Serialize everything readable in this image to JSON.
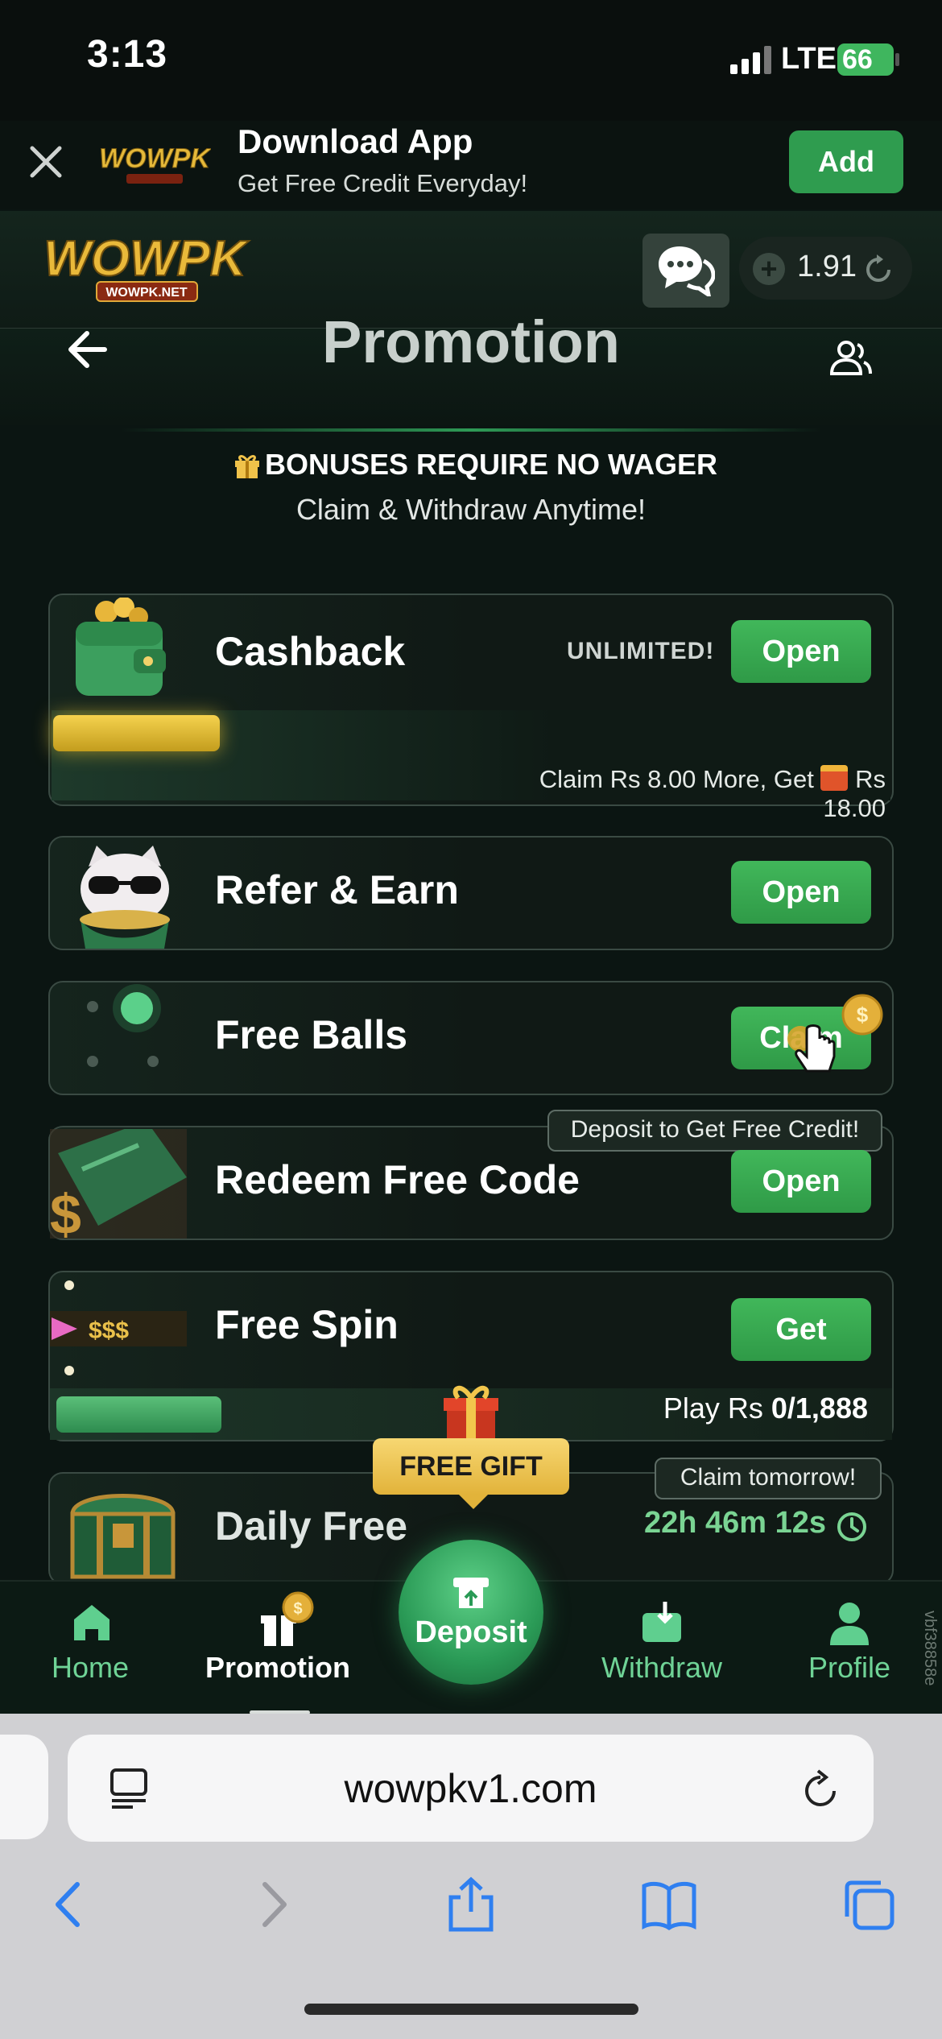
{
  "status": {
    "time": "3:13",
    "network": "LTE",
    "battery": "66"
  },
  "banner": {
    "title": "Download App",
    "subtitle": "Get Free Credit Everyday!",
    "add_label": "Add",
    "logo_text": "WOWPK"
  },
  "header": {
    "logo_text": "WOWPK",
    "logo_sub": "WOWPK.NET",
    "balance": "1.91"
  },
  "promo": {
    "title": "Promotion",
    "bonus_line1": "BONUSES REQUIRE NO WAGER",
    "bonus_line2": "Claim & Withdraw Anytime!"
  },
  "cards": {
    "cashback": {
      "title": "Cashback",
      "badge": "UNLIMITED!",
      "button": "Open",
      "claim_prefix": "Claim Rs 8.00 More, Get",
      "claim_suffix": "Rs 18.00"
    },
    "refer": {
      "title": "Refer & Earn",
      "button": "Open"
    },
    "balls": {
      "title": "Free Balls",
      "button": "Claim"
    },
    "redeem": {
      "title": "Redeem Free Code",
      "button": "Open",
      "tooltip": "Deposit to Get Free Credit!"
    },
    "spin": {
      "title": "Free Spin",
      "button": "Get",
      "play_prefix": "Play Rs",
      "play_value": "0/1,888",
      "label": "$$$"
    },
    "daily": {
      "title": "Daily Free",
      "tooltip": "Claim tomorrow!",
      "timer": "22h 46m 12s"
    }
  },
  "free_gift": "FREE GIFT",
  "nav": {
    "home": "Home",
    "promotion": "Promotion",
    "deposit": "Deposit",
    "withdraw": "Withdraw",
    "profile": "Profile",
    "side_id": "vbf38858e"
  },
  "browser": {
    "url": "wowpkv1.com"
  },
  "colors": {
    "accent": "#3fb65e",
    "nav_text": "#6fd396",
    "timer": "#7ad493",
    "gold": "#e2b33a"
  }
}
